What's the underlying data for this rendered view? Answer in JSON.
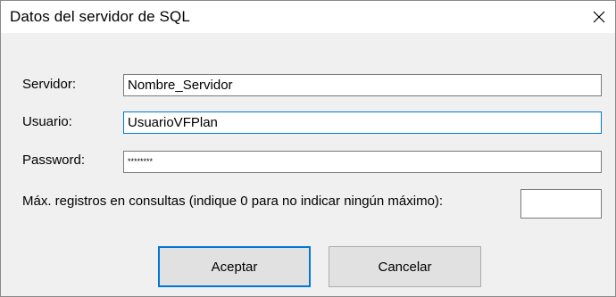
{
  "window": {
    "title": "Datos del servidor de SQL",
    "close_icon": "close-icon"
  },
  "form": {
    "servidor": {
      "label": "Servidor:",
      "value": "Nombre_Servidor"
    },
    "usuario": {
      "label": "Usuario:",
      "value": "UsuarioVFPlan"
    },
    "password": {
      "label": "Password:",
      "value": "********"
    },
    "max_registros": {
      "label": "Máx. registros en consultas (indique 0 para no indicar ningún máximo):",
      "value": ""
    }
  },
  "buttons": {
    "accept_label": "Aceptar",
    "cancel_label": "Cancelar"
  },
  "colors": {
    "focus_accent": "#0078d7",
    "client_background": "#f0f0f0"
  }
}
